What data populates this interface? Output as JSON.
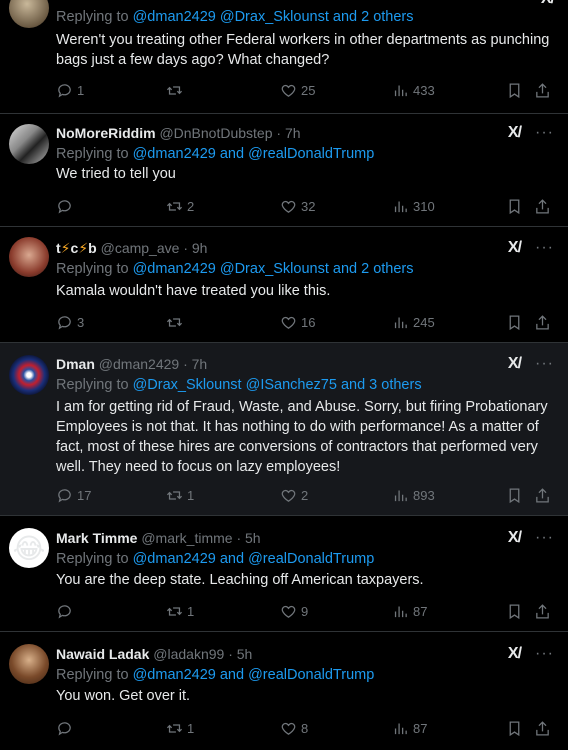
{
  "tweets": [
    {
      "name": "",
      "handle": "",
      "time": "",
      "replying_label": "Replying to",
      "replying_mentions": "@dman2429 @Drax_Sklounst and 2 others",
      "text": "Weren't you treating other Federal workers in other departments as punching bags just a few days ago? What changed?",
      "replies": "1",
      "retweets": "",
      "likes": "25",
      "views": "433"
    },
    {
      "name": "NoMoreRiddim",
      "handle": "@DnBnotDubstep",
      "time": "· 7h",
      "replying_label": "Replying to",
      "replying_mentions": "@dman2429 and @realDonaldTrump",
      "text": "We tried to tell you",
      "replies": "",
      "retweets": "2",
      "likes": "32",
      "views": "310"
    },
    {
      "name": "t⚡c⚡b",
      "handle": "@camp_ave",
      "time": "· 9h",
      "replying_label": "Replying to",
      "replying_mentions": "@dman2429 @Drax_Sklounst and 2 others",
      "text": "Kamala wouldn't have treated you like this.",
      "replies": "3",
      "retweets": "",
      "likes": "16",
      "views": "245"
    },
    {
      "name": "Dman",
      "handle": "@dman2429",
      "time": "· 7h",
      "replying_label": "Replying to",
      "replying_mentions": "@Drax_Sklounst @ISanchez75 and 3 others",
      "text": "I am for getting rid of Fraud, Waste, and Abuse. Sorry, but firing Probationary Employees is not that.  It has nothing to do with performance! As a matter of fact, most of these hires are conversions of contractors that performed very well. They need to focus on lazy employees!",
      "replies": "17",
      "retweets": "1",
      "likes": "2",
      "views": "893"
    },
    {
      "name": "Mark Timme",
      "handle": "@mark_timme",
      "time": "· 5h",
      "replying_label": "Replying to",
      "replying_mentions": "@dman2429 and @realDonaldTrump",
      "text": "You are the deep state. Leaching off American taxpayers.",
      "replies": "",
      "retweets": "1",
      "likes": "9",
      "views": "87"
    },
    {
      "name": "Nawaid Ladak",
      "handle": "@ladakn99",
      "time": "· 5h",
      "replying_label": "Replying to",
      "replying_mentions": "@dman2429 and @realDonaldTrump",
      "text": "You won. Get over it.",
      "replies": "",
      "retweets": "1",
      "likes": "8",
      "views": "87"
    }
  ],
  "icons": {
    "reply": "reply-icon",
    "retweet": "retweet-icon",
    "like": "heart-icon",
    "views": "views-icon",
    "bookmark": "bookmark-icon",
    "share": "share-icon",
    "grok": "grok-icon",
    "more": "more-icon"
  },
  "colors": {
    "background": "#000000",
    "link": "#1d9bf0",
    "muted": "#71767b",
    "text": "#e7e9ea",
    "divider": "#2f3336"
  }
}
